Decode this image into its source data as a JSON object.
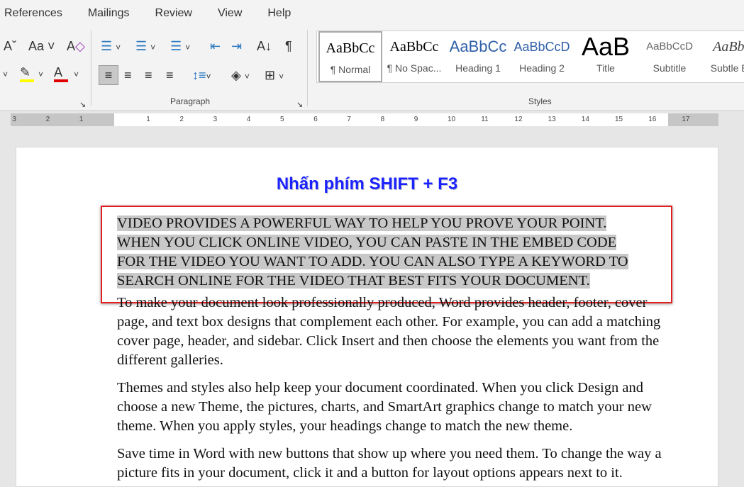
{
  "menu": [
    "References",
    "Mailings",
    "Review",
    "View",
    "Help"
  ],
  "ribbon": {
    "paragraph_label": "Paragraph",
    "styles_label": "Styles",
    "highlight_color": "#ffff00",
    "font_color": "#e00000",
    "styles": [
      {
        "preview": "AaBbCc",
        "label": "¶ Normal"
      },
      {
        "preview": "AaBbCc",
        "label": "¶ No Spac..."
      },
      {
        "preview": "AaBbCc",
        "label": "Heading 1"
      },
      {
        "preview": "AaBbCcD",
        "label": "Heading 2"
      },
      {
        "preview": "AaB",
        "label": "Title"
      },
      {
        "preview": "AaBbCcD",
        "label": "Subtitle"
      },
      {
        "preview": "AaBbC",
        "label": "Subtle Em"
      }
    ]
  },
  "ruler": [
    "3",
    "2",
    "1",
    "1",
    "2",
    "3",
    "4",
    "5",
    "6",
    "7",
    "8",
    "9",
    "10",
    "11",
    "12",
    "13",
    "14",
    "15",
    "16",
    "17"
  ],
  "document": {
    "annotation": "Nhấn phím SHIFT + F3",
    "selected_lines": [
      "VIDEO PROVIDES A POWERFUL WAY TO HELP YOU PROVE YOUR POINT.",
      "WHEN YOU CLICK ONLINE VIDEO, YOU CAN PASTE IN THE EMBED CODE",
      "FOR THE VIDEO YOU WANT TO ADD. YOU CAN ALSO TYPE A KEYWORD TO",
      "SEARCH ONLINE FOR THE VIDEO THAT BEST FITS YOUR DOCUMENT."
    ],
    "paragraphs": [
      "To make your document look professionally produced, Word provides header, footer, cover page, and text box designs that complement each other. For example, you can add a matching cover page, header, and sidebar. Click Insert and then choose the elements you want from the different galleries.",
      "Themes and styles also help keep your document coordinated. When you click Design and choose a new Theme, the pictures, charts, and SmartArt graphics change to match your new theme. When you apply styles, your headings change to match the new theme.",
      "Save time in Word with new buttons that show up where you need them. To change the way a picture fits in your document, click it and a button for layout options appears next to it."
    ]
  }
}
